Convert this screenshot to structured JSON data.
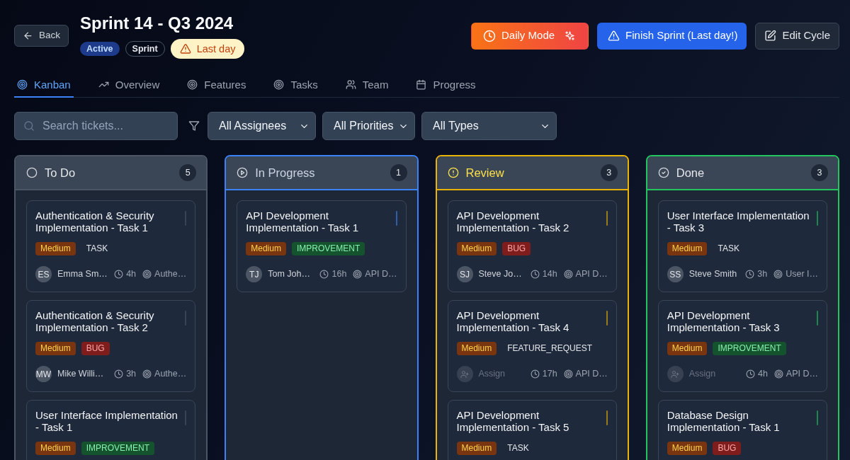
{
  "header": {
    "back_label": "Back",
    "title": "Sprint 14 - Q3 2024",
    "badges": [
      {
        "label": "Active",
        "kind": "status"
      },
      {
        "label": "Sprint",
        "kind": "outline"
      },
      {
        "label": "Last day",
        "kind": "warning"
      }
    ],
    "actions": [
      {
        "label": "Daily Mode",
        "kind": "daily"
      },
      {
        "label": "Finish Sprint (Last day!)",
        "kind": "primary"
      },
      {
        "label": "Edit Cycle",
        "kind": "secondary"
      }
    ]
  },
  "tabs": [
    {
      "label": "Kanban",
      "selected": true
    },
    {
      "label": "Overview",
      "selected": false
    },
    {
      "label": "Features",
      "selected": false
    },
    {
      "label": "Tasks",
      "selected": false
    },
    {
      "label": "Team",
      "selected": false
    },
    {
      "label": "Progress",
      "selected": false
    }
  ],
  "filters": {
    "search": {
      "placeholder": "Search tickets..."
    },
    "dropdowns": [
      {
        "value": "All Assignees"
      },
      {
        "value": "All Priorities"
      },
      {
        "value": "All Types"
      }
    ]
  },
  "columns": [
    {
      "kind": "todo",
      "title": "To Do",
      "count": "5",
      "color": "#4b5563",
      "cards": [
        {
          "title": "Authentication & Security Implementation - Task 1",
          "priority": {
            "label": "Medium",
            "kind": "medium"
          },
          "type": {
            "label": "TASK",
            "kind": "task"
          },
          "assignee": {
            "kind": "user",
            "initials": "ES",
            "name": "Emma Sm…"
          },
          "hours": "4h",
          "feature": "Authe…"
        },
        {
          "title": "Authentication & Security Implementation - Task 2",
          "priority": {
            "label": "Medium",
            "kind": "medium"
          },
          "type": {
            "label": "BUG",
            "kind": "bug"
          },
          "assignee": {
            "kind": "user",
            "initials": "MW",
            "name": "Mike Willi…"
          },
          "hours": "3h",
          "feature": "Authe…"
        },
        {
          "title": "User Interface Implementation - Task 1",
          "priority": {
            "label": "Medium",
            "kind": "medium"
          },
          "type": {
            "label": "IMPROVEMENT",
            "kind": "improvement"
          }
        }
      ]
    },
    {
      "kind": "progress",
      "title": "In Progress",
      "count": "1",
      "color": "#3b82f6",
      "cards": [
        {
          "title": "API Development Implementation - Task 1",
          "priority": {
            "label": "Medium",
            "kind": "medium"
          },
          "type": {
            "label": "IMPROVEMENT",
            "kind": "improvement"
          },
          "assignee": {
            "kind": "user",
            "initials": "TJ",
            "name": "Tom Joh…"
          },
          "hours": "16h",
          "feature": "API D…"
        }
      ]
    },
    {
      "kind": "review",
      "title": "Review",
      "count": "3",
      "color": "#eab308",
      "cards": [
        {
          "title": "API Development Implementation - Task 2",
          "priority": {
            "label": "Medium",
            "kind": "medium"
          },
          "type": {
            "label": "BUG",
            "kind": "bug"
          },
          "assignee": {
            "kind": "user",
            "initials": "SJ",
            "name": "Steve Jo…"
          },
          "hours": "14h",
          "feature": "API D…"
        },
        {
          "title": "API Development Implementation - Task 4",
          "priority": {
            "label": "Medium",
            "kind": "medium"
          },
          "type": {
            "label": "FEATURE_REQUEST",
            "kind": "feature_request"
          },
          "assignee": {
            "kind": "unassigned",
            "name": "Assign"
          },
          "hours": "17h",
          "feature": "API D…"
        },
        {
          "title": "API Development Implementation - Task 5",
          "priority": {
            "label": "Medium",
            "kind": "medium"
          },
          "type": {
            "label": "TASK",
            "kind": "task"
          }
        }
      ]
    },
    {
      "kind": "done",
      "title": "Done",
      "count": "3",
      "color": "#22c55e",
      "cards": [
        {
          "title": "User Interface Implementation - Task 3",
          "priority": {
            "label": "Medium",
            "kind": "medium"
          },
          "type": {
            "label": "TASK",
            "kind": "task"
          },
          "assignee": {
            "kind": "user",
            "initials": "SS",
            "name": "Steve Smith"
          },
          "hours": "3h",
          "feature": "User I…"
        },
        {
          "title": "API Development Implementation - Task 3",
          "priority": {
            "label": "Medium",
            "kind": "medium"
          },
          "type": {
            "label": "IMPROVEMENT",
            "kind": "improvement"
          },
          "assignee": {
            "kind": "unassigned",
            "name": "Assign"
          },
          "hours": "4h",
          "feature": "API D…"
        },
        {
          "title": "Database Design Implementation - Task 1",
          "priority": {
            "label": "Medium",
            "kind": "medium"
          },
          "type": {
            "label": "BUG",
            "kind": "bug"
          }
        }
      ]
    }
  ]
}
